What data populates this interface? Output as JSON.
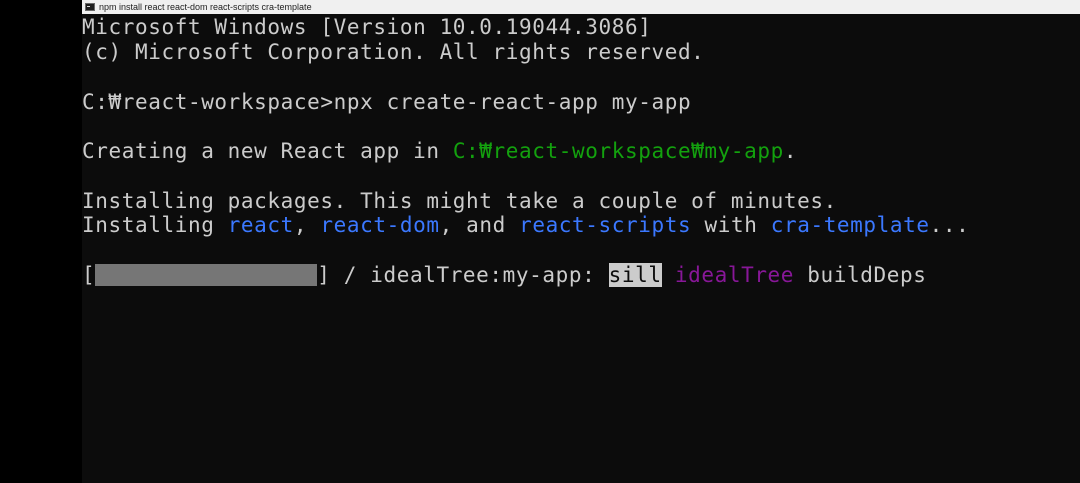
{
  "window": {
    "title": "npm install react react-dom react-scripts cra-template"
  },
  "console": {
    "header1": "Microsoft Windows [Version 10.0.19044.3086]",
    "header2": "(c) Microsoft Corporation. All rights reserved.",
    "prompt_command": "C:₩react-workspace>npx create-react-app my-app",
    "creating_prefix": "Creating a new React app in ",
    "creating_path": "C:₩react-workspace₩my-app",
    "creating_suffix": ".",
    "installing_line1": "Installing packages. This might take a couple of minutes.",
    "installing_prefix": "Installing ",
    "pkg_react": "react",
    "sep1": ", ",
    "pkg_react_dom": "react-dom",
    "sep2": ", and ",
    "pkg_react_scripts": "react-scripts",
    "with_text": " with ",
    "pkg_cra_template": "cra-template",
    "ellipsis": "...",
    "progress": {
      "open_bracket": "[",
      "close_bracket": "]",
      "fraction": 1.0,
      "spinner": " / ",
      "status_prefix": "idealTree:my-app: ",
      "level": "sill",
      "stage": "idealTree",
      "action": " buildDeps"
    }
  },
  "colors": {
    "background": "#0c0c0c",
    "text": "#cccccc",
    "path_green": "#13a10e",
    "package_blue": "#3b78ff",
    "stage_purple": "#881798",
    "progress_bar": "#767676"
  }
}
